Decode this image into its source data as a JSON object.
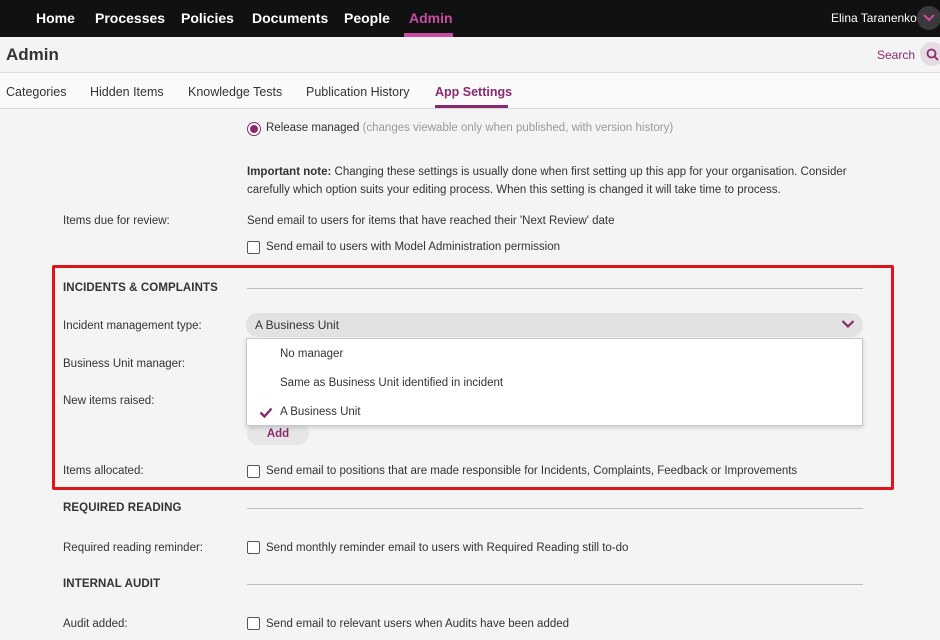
{
  "topnav": {
    "items": [
      "Home",
      "Processes",
      "Policies",
      "Documents",
      "People",
      "Admin"
    ],
    "active": "Admin",
    "user_name": "Elina Taranenko",
    "user_menu_icon": "chevron-down-icon"
  },
  "header": {
    "title": "Admin",
    "search_label": "Search",
    "search_icon": "search-icon"
  },
  "tabs": [
    "Categories",
    "Hidden Items",
    "Knowledge Tests",
    "Publication History",
    "App Settings"
  ],
  "active_tab": "App Settings",
  "publishing": {
    "release_option_label": "Release managed",
    "release_option_hint": "(changes viewable only when published, with version history)",
    "release_selected": true,
    "note_bold": "Important note:",
    "note_line1": " Changing these settings is usually done when first setting up this app for your organisation. Consider",
    "note_line2": "carefully which option suits your editing process. When this setting is changed it will take time to process."
  },
  "review": {
    "label": "Items due for review:",
    "description": "Send email to users for items that have reached their 'Next Review' date",
    "checkbox_label": "Send email to users with Model Administration permission",
    "checked": false
  },
  "incidents": {
    "heading": "INCIDENTS & COMPLAINTS",
    "type_label": "Incident management type:",
    "type_value": "A Business Unit",
    "type_options": [
      "No manager",
      "Same as Business Unit identified in incident",
      "A Business Unit"
    ],
    "type_selected_index": 2,
    "bu_manager_label": "Business Unit manager:",
    "new_items_label": "New items raised:",
    "add_button": "Add",
    "allocated_label": "Items allocated:",
    "allocated_checkbox_label": "Send email to positions that are made responsible for Incidents, Complaints, Feedback or Improvements",
    "allocated_checked": false
  },
  "required_reading": {
    "heading": "REQUIRED READING",
    "reminder_label": "Required reading reminder:",
    "reminder_checkbox_label": "Send monthly reminder email to users with Required Reading still to-do",
    "checked": false
  },
  "internal_audit": {
    "heading": "INTERNAL AUDIT",
    "audit_added_label": "Audit added:",
    "audit_added_checkbox_label": "Send email to relevant users when Audits have been added",
    "checked": false
  },
  "colors": {
    "accent": "#8a2a6e",
    "nav_active": "#c94ba2",
    "nav_bg": "#111111",
    "highlight": "#e0141b"
  }
}
